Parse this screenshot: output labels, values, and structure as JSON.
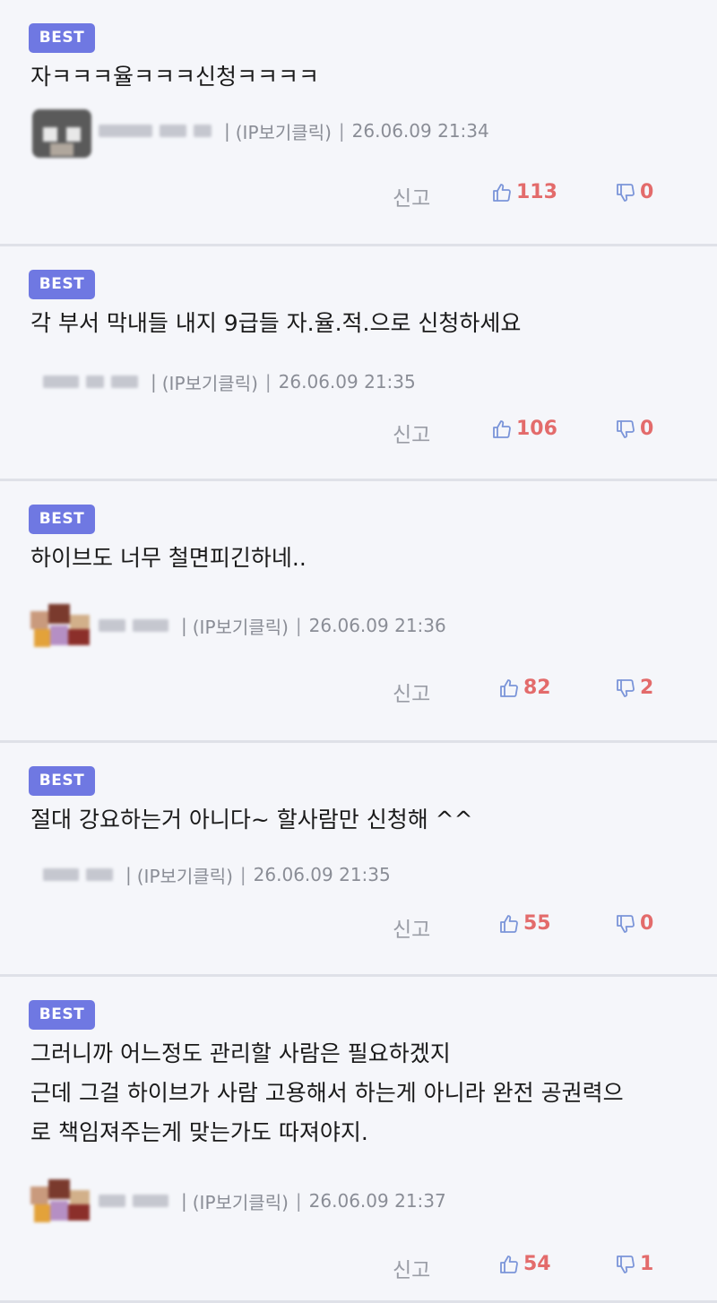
{
  "comments": [
    {
      "badge": "BEST",
      "lines": [
        "자ㅋㅋㅋ율ㅋㅋㅋ신청ㅋㅋㅋㅋ"
      ],
      "ip_label": "(IP보기클릭)",
      "sep": "|",
      "timestamp": "26.06.09 21:34",
      "report_label": "신고",
      "likes": "113",
      "dislikes": "0"
    },
    {
      "badge": "BEST",
      "lines": [
        "각 부서 막내들 내지 9급들 자.율.적.으로 신청하세요"
      ],
      "ip_label": "(IP보기클릭)",
      "sep": "|",
      "timestamp": "26.06.09 21:35",
      "report_label": "신고",
      "likes": "106",
      "dislikes": "0"
    },
    {
      "badge": "BEST",
      "lines": [
        "하이브도 너무 철면피긴하네.."
      ],
      "ip_label": "(IP보기클릭)",
      "sep": "|",
      "timestamp": "26.06.09 21:36",
      "report_label": "신고",
      "likes": "82",
      "dislikes": "2"
    },
    {
      "badge": "BEST",
      "lines": [
        "절대 강요하는거 아니다~ 할사람만 신청해 ^^"
      ],
      "ip_label": "(IP보기클릭)",
      "sep": "|",
      "timestamp": "26.06.09 21:35",
      "report_label": "신고",
      "likes": "55",
      "dislikes": "0"
    },
    {
      "badge": "BEST",
      "lines": [
        "그러니까 어느정도 관리할 사람은 필요하겠지",
        "근데 그걸 하이브가 사람 고용해서 하는게 아니라 완전 공권력으",
        "로 책임져주는게 맞는가도 따져야지."
      ],
      "ip_label": "(IP보기클릭)",
      "sep": "|",
      "timestamp": "26.06.09 21:37",
      "report_label": "신고",
      "likes": "54",
      "dislikes": "1"
    }
  ],
  "colors": {
    "badge_bg": "#6f78e2",
    "like_count": "#e36b6b",
    "like_icon": "#7b95d9",
    "background": "#f5f6fa"
  },
  "icons": {
    "like": "thumbs-up-icon",
    "dislike": "thumbs-down-icon"
  }
}
